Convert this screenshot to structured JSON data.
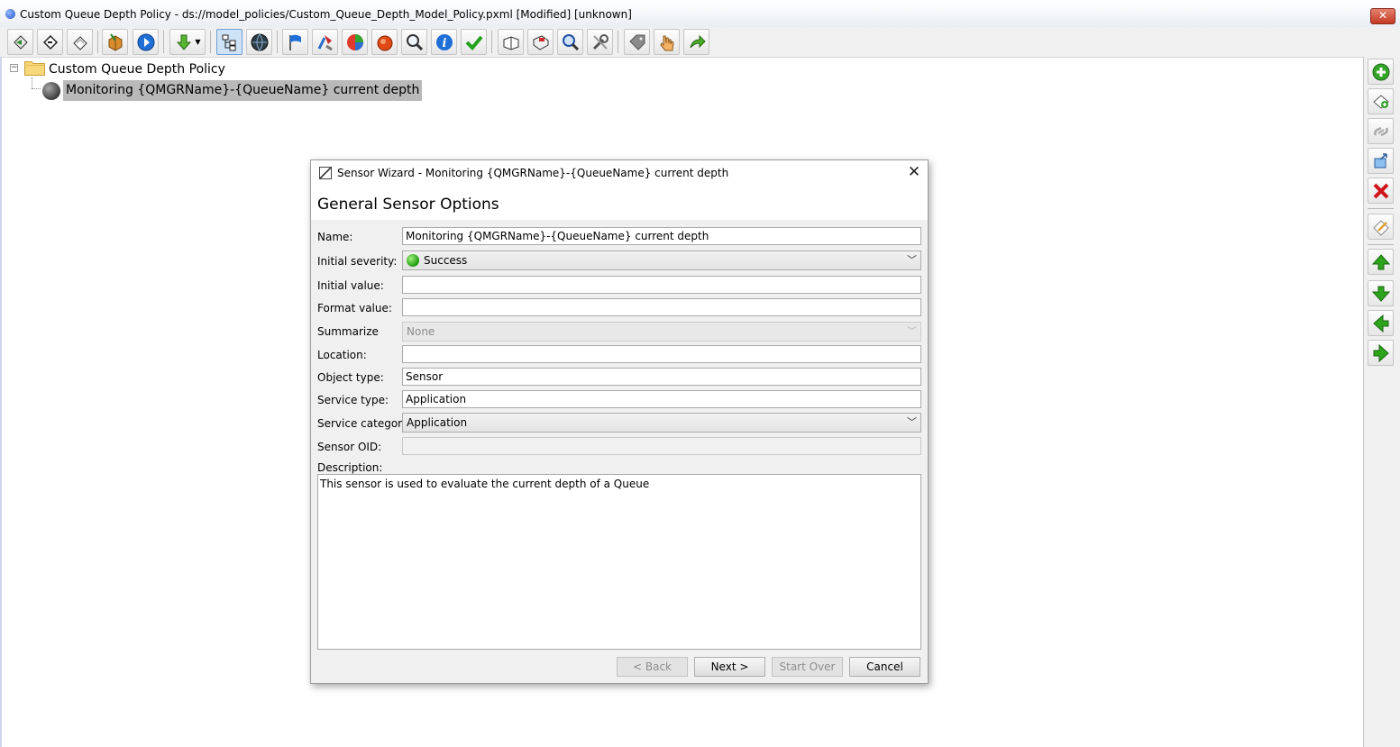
{
  "window": {
    "title": "Custom Queue Depth Policy - ds://model_policies/Custom_Queue_Depth_Model_Policy.pxml [Modified] [unknown]",
    "close_glyph": "✕"
  },
  "toolbar": {
    "icons": [
      "back-icon",
      "forward-icon",
      "eraser-icon",
      "package-icon",
      "play-icon",
      "download-icon",
      "tree-view-icon",
      "globe-icon",
      "flag-icon",
      "tool-icon",
      "pie-chart-icon",
      "alarm-icon",
      "search-icon",
      "info-icon",
      "check-icon",
      "book-icon",
      "calendar-icon",
      "zoom-icon",
      "wrench-icon",
      "tag-icon",
      "hand-icon",
      "undo-icon"
    ]
  },
  "tree": {
    "expander": "−",
    "root_label": "Custom Queue Depth Policy",
    "child_label": "Monitoring {QMGRName}-{QueueName} current depth"
  },
  "dialog": {
    "title": "Sensor Wizard - Monitoring {QMGRName}-{QueueName} current depth",
    "close_glyph": "✕",
    "heading": "General Sensor Options",
    "fields": {
      "name_label": "Name:",
      "name_value": "Monitoring {QMGRName}-{QueueName} current depth",
      "initial_severity_label": "Initial severity:",
      "initial_severity_value": "Success",
      "initial_value_label": "Initial value:",
      "initial_value_value": "",
      "format_value_label": "Format value:",
      "format_value_value": "",
      "summarize_label": "Summarize",
      "summarize_value": "None",
      "location_label": "Location:",
      "location_value": "",
      "object_type_label": "Object type:",
      "object_type_value": "Sensor",
      "service_type_label": "Service type:",
      "service_type_value": "Application",
      "service_category_label": "Service category:",
      "service_category_value": "Application",
      "sensor_oid_label": "Sensor OID:",
      "sensor_oid_value": "",
      "description_label": "Description:",
      "description_value": "This sensor is used to evaluate the current depth of a Queue"
    },
    "buttons": {
      "back": "< Back",
      "next": "Next >",
      "start_over": "Start Over",
      "cancel": "Cancel"
    }
  },
  "right_toolbar": {
    "icons": [
      "add-icon",
      "add-item-icon",
      "link-icon",
      "copy-icon",
      "delete-icon",
      "edit-icon",
      "move-up-icon",
      "move-down-icon",
      "move-left-icon",
      "move-right-icon"
    ]
  },
  "colors": {
    "severity_success": "#1d9a10",
    "selection": "#b9b9b9",
    "delete_red": "#d0141a",
    "arrow_green": "#2da51b"
  }
}
